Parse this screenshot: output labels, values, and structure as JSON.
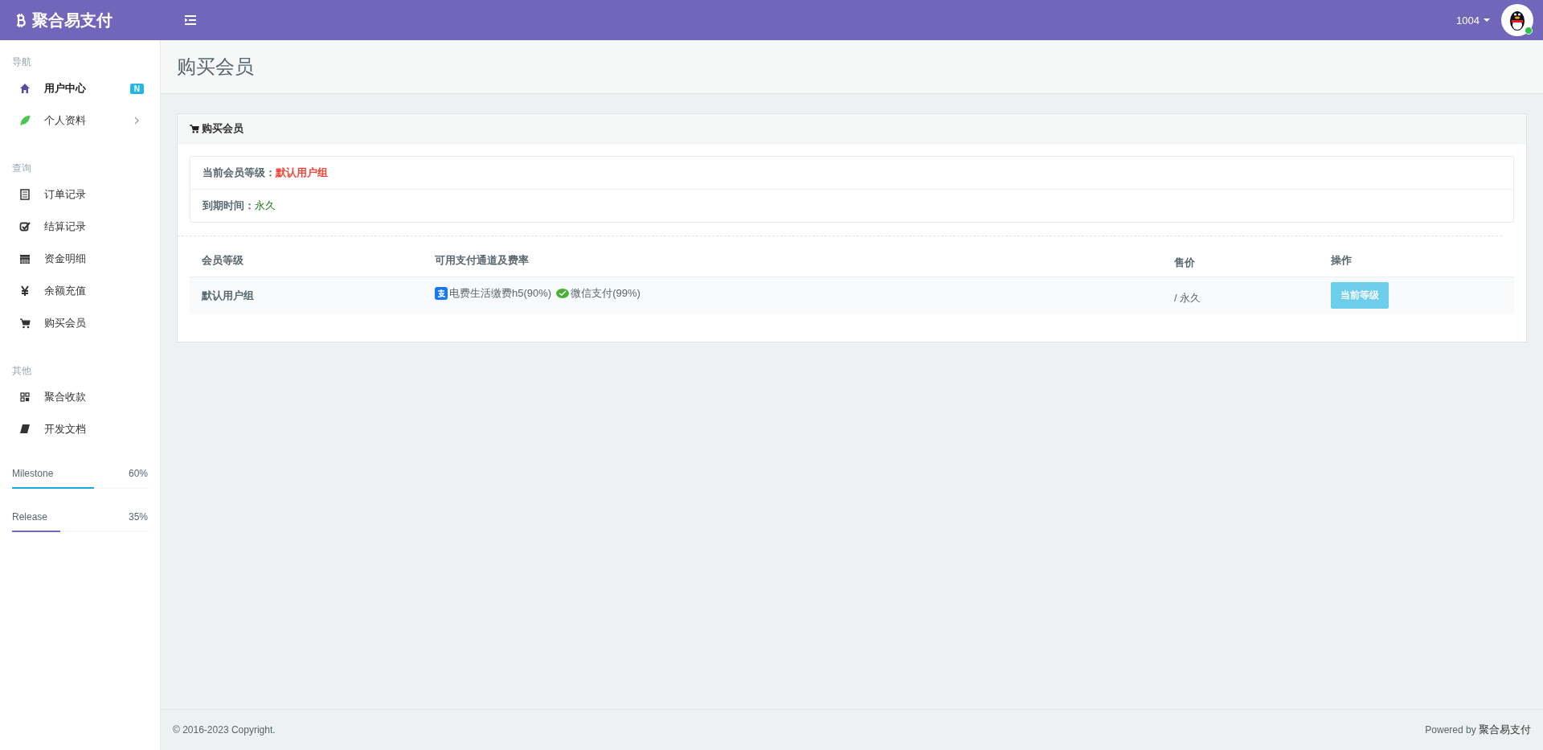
{
  "header": {
    "brand": "聚合易支付",
    "user": "1004"
  },
  "sidebar": {
    "sections": [
      {
        "title": "导航",
        "items": [
          {
            "label": "用户中心",
            "selected": true,
            "badge": "N",
            "submenu": false
          },
          {
            "label": "个人资料",
            "selected": false,
            "submenu": true
          }
        ]
      },
      {
        "title": "查询",
        "items": [
          {
            "label": "订单记录",
            "selected": false,
            "submenu": false
          },
          {
            "label": "结算记录",
            "selected": false,
            "submenu": false
          },
          {
            "label": "资金明细",
            "selected": false,
            "submenu": false
          },
          {
            "label": "余额充值",
            "selected": false,
            "submenu": false
          },
          {
            "label": "购买会员",
            "selected": false,
            "submenu": false
          }
        ]
      },
      {
        "title": "其他",
        "items": [
          {
            "label": "聚合收款",
            "selected": false,
            "submenu": false
          },
          {
            "label": "开发文档",
            "selected": false,
            "submenu": false
          }
        ]
      }
    ],
    "progress": [
      {
        "name": "Milestone",
        "reading": "60%",
        "level": 0.6,
        "color": "#1ca8dd"
      },
      {
        "name": "Release",
        "reading": "35%",
        "level": 0.35,
        "color": "#7266ba"
      }
    ]
  },
  "page_title": "购买会员",
  "card": {
    "title": "购买会员",
    "info": [
      {
        "label": "当前会员等级：",
        "value": "默认用户组",
        "color": "#f44336"
      },
      {
        "label": "到期时间：",
        "value": "永久",
        "color": "#1b7e1b"
      }
    ],
    "table": {
      "columns": [
        "会员等级",
        "可用支付通道及费率",
        "售价",
        "操作"
      ],
      "rows": [
        {
          "level": "默认用户组",
          "channels": [
            {
              "kind": "alipay",
              "label": "电费生活缴费h5(90%)"
            },
            {
              "kind": "wechat",
              "label": "微信支付(99%)"
            }
          ],
          "price": "/ 永久",
          "action": "当前等级",
          "disabled": true
        }
      ]
    }
  },
  "footer": {
    "copyright": "© 2016-2023 Copyright.",
    "powered_prefix": "Powered by",
    "powered_brand": "聚合易支付"
  }
}
